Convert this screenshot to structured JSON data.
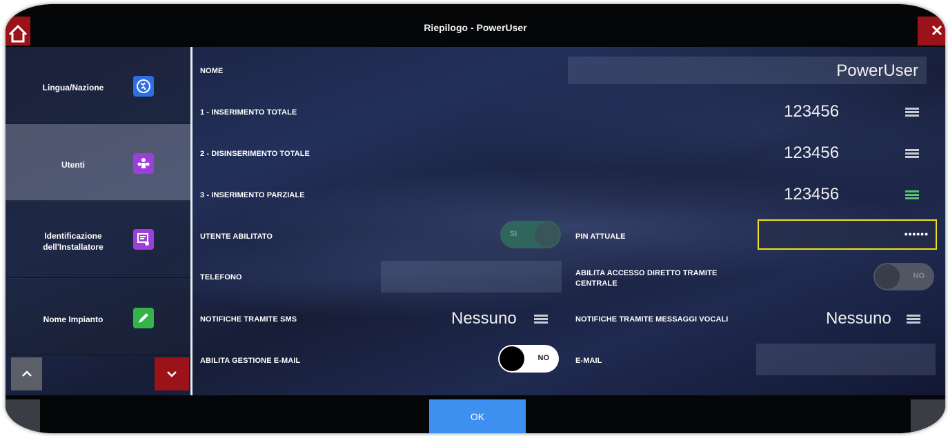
{
  "window": {
    "title": "Riepilogo - PowerUser"
  },
  "sidebar": {
    "items": [
      {
        "label": "Lingua/Nazione",
        "icon": "globe-icon",
        "icon_color": "#2f6ee0"
      },
      {
        "label": "Utenti",
        "icon": "users-icon",
        "icon_color": "#9b3fd8"
      },
      {
        "label": "Identificazione dell'Installatore",
        "icon": "installer-id-icon",
        "icon_color": "#9b3fd8"
      },
      {
        "label": "Nome Impianto",
        "icon": "pencil-icon",
        "icon_color": "#36b24a"
      }
    ]
  },
  "form": {
    "nome": {
      "label": "NOME",
      "value": "PowerUser"
    },
    "codes": [
      {
        "label": "1 - INSERIMENTO TOTALE",
        "value": "123456",
        "menu_color": "#c9ccd3"
      },
      {
        "label": "2 - DISINSERIMENTO TOTALE",
        "value": "123456",
        "menu_color": "#c9ccd3"
      },
      {
        "label": "3 - INSERIMENTO PARZIALE",
        "value": "123456",
        "menu_color": "#57c66a"
      }
    ],
    "utente_abilitato": {
      "label": "UTENTE ABILITATO",
      "toggle_text": "SI"
    },
    "pin_attuale": {
      "label": "PIN ATTUALE",
      "value": "••••••"
    },
    "telefono": {
      "label": "TELEFONO",
      "value": ""
    },
    "accesso_diretto": {
      "label": "ABILITA ACCESSO DIRETTO TRAMITE CENTRALE",
      "toggle_text": "NO"
    },
    "notifiche_sms": {
      "label": "NOTIFICHE TRAMITE SMS",
      "value": "Nessuno"
    },
    "notifiche_vocali": {
      "label": "NOTIFICHE TRAMITE MESSAGGI VOCALI",
      "value": "Nessuno"
    },
    "gestione_email": {
      "label": "ABILITA GESTIONE E-MAIL",
      "toggle_text": "NO"
    },
    "email": {
      "label": "E-MAIL",
      "value": ""
    }
  },
  "footer": {
    "ok_label": "OK"
  },
  "colors": {
    "accent_red": "#9b1318",
    "ok_blue": "#3d8ff0",
    "highlight_yellow": "#f2e21b",
    "toggle_green": "#2f8f6b"
  }
}
